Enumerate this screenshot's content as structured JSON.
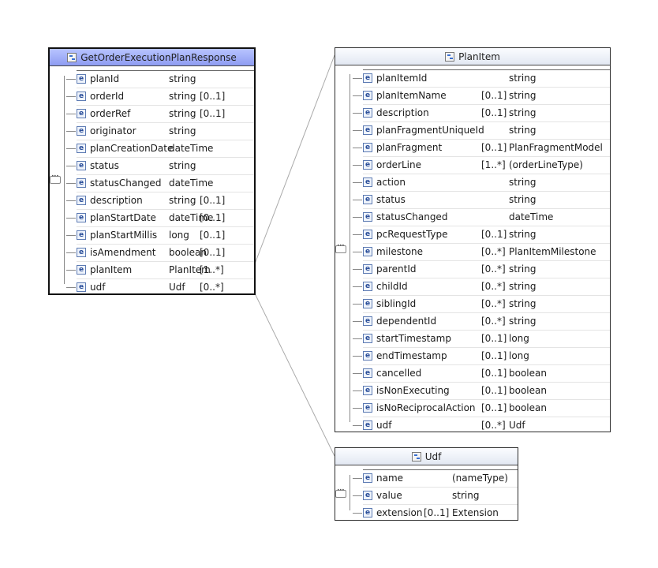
{
  "boxes": {
    "response": {
      "title": "GetOrderExecutionPlanResponse",
      "rows": [
        {
          "name": "planId",
          "card": "",
          "type": "string"
        },
        {
          "name": "orderId",
          "card": "[0..1]",
          "type": "string"
        },
        {
          "name": "orderRef",
          "card": "[0..1]",
          "type": "string"
        },
        {
          "name": "originator",
          "card": "",
          "type": "string"
        },
        {
          "name": "planCreationDate",
          "card": "",
          "type": "dateTime"
        },
        {
          "name": "status",
          "card": "",
          "type": "string"
        },
        {
          "name": "statusChanged",
          "card": "",
          "type": "dateTime"
        },
        {
          "name": "description",
          "card": "[0..1]",
          "type": "string"
        },
        {
          "name": "planStartDate",
          "card": "[0..1]",
          "type": "dateTime"
        },
        {
          "name": "planStartMillis",
          "card": "[0..1]",
          "type": "long"
        },
        {
          "name": "isAmendment",
          "card": "[0..1]",
          "type": "boolean"
        },
        {
          "name": "planItem",
          "card": "[1..*]",
          "type": "PlanItem"
        },
        {
          "name": "udf",
          "card": "[0..*]",
          "type": "Udf"
        }
      ]
    },
    "planItem": {
      "title": "PlanItem",
      "rows": [
        {
          "name": "planItemId",
          "card": "",
          "type": "string"
        },
        {
          "name": "planItemName",
          "card": "[0..1]",
          "type": "string"
        },
        {
          "name": "description",
          "card": "[0..1]",
          "type": "string"
        },
        {
          "name": "planFragmentUniqueId",
          "card": "",
          "type": "string"
        },
        {
          "name": "planFragment",
          "card": "[0..1]",
          "type": "PlanFragmentModel"
        },
        {
          "name": "orderLine",
          "card": "[1..*]",
          "type": "(orderLineType)"
        },
        {
          "name": "action",
          "card": "",
          "type": "string"
        },
        {
          "name": "status",
          "card": "",
          "type": "string"
        },
        {
          "name": "statusChanged",
          "card": "",
          "type": "dateTime"
        },
        {
          "name": "pcRequestType",
          "card": "[0..1]",
          "type": "string"
        },
        {
          "name": "milestone",
          "card": "[0..*]",
          "type": "PlanItemMilestone"
        },
        {
          "name": "parentId",
          "card": "[0..*]",
          "type": "string"
        },
        {
          "name": "childId",
          "card": "[0..*]",
          "type": "string"
        },
        {
          "name": "siblingId",
          "card": "[0..*]",
          "type": "string"
        },
        {
          "name": "dependentId",
          "card": "[0..*]",
          "type": "string"
        },
        {
          "name": "startTimestamp",
          "card": "[0..1]",
          "type": "long"
        },
        {
          "name": "endTimestamp",
          "card": "[0..1]",
          "type": "long"
        },
        {
          "name": "cancelled",
          "card": "[0..1]",
          "type": "boolean"
        },
        {
          "name": "isNonExecuting",
          "card": "[0..1]",
          "type": "boolean"
        },
        {
          "name": "isNoReciprocalAction",
          "card": "[0..1]",
          "type": "boolean"
        },
        {
          "name": "udf",
          "card": "[0..*]",
          "type": "Udf"
        }
      ]
    },
    "udf": {
      "title": "Udf",
      "rows": [
        {
          "name": "name",
          "card": "",
          "type": "(nameType)"
        },
        {
          "name": "value",
          "card": "",
          "type": "string"
        },
        {
          "name": "extension",
          "card": "[0..1]",
          "type": "Extension"
        }
      ]
    }
  },
  "element_icon_glyph": "e",
  "colors": {
    "selected_header": "#8e9cf2",
    "element_icon": "#2b4f9a",
    "connector": "#aaaaaa"
  }
}
